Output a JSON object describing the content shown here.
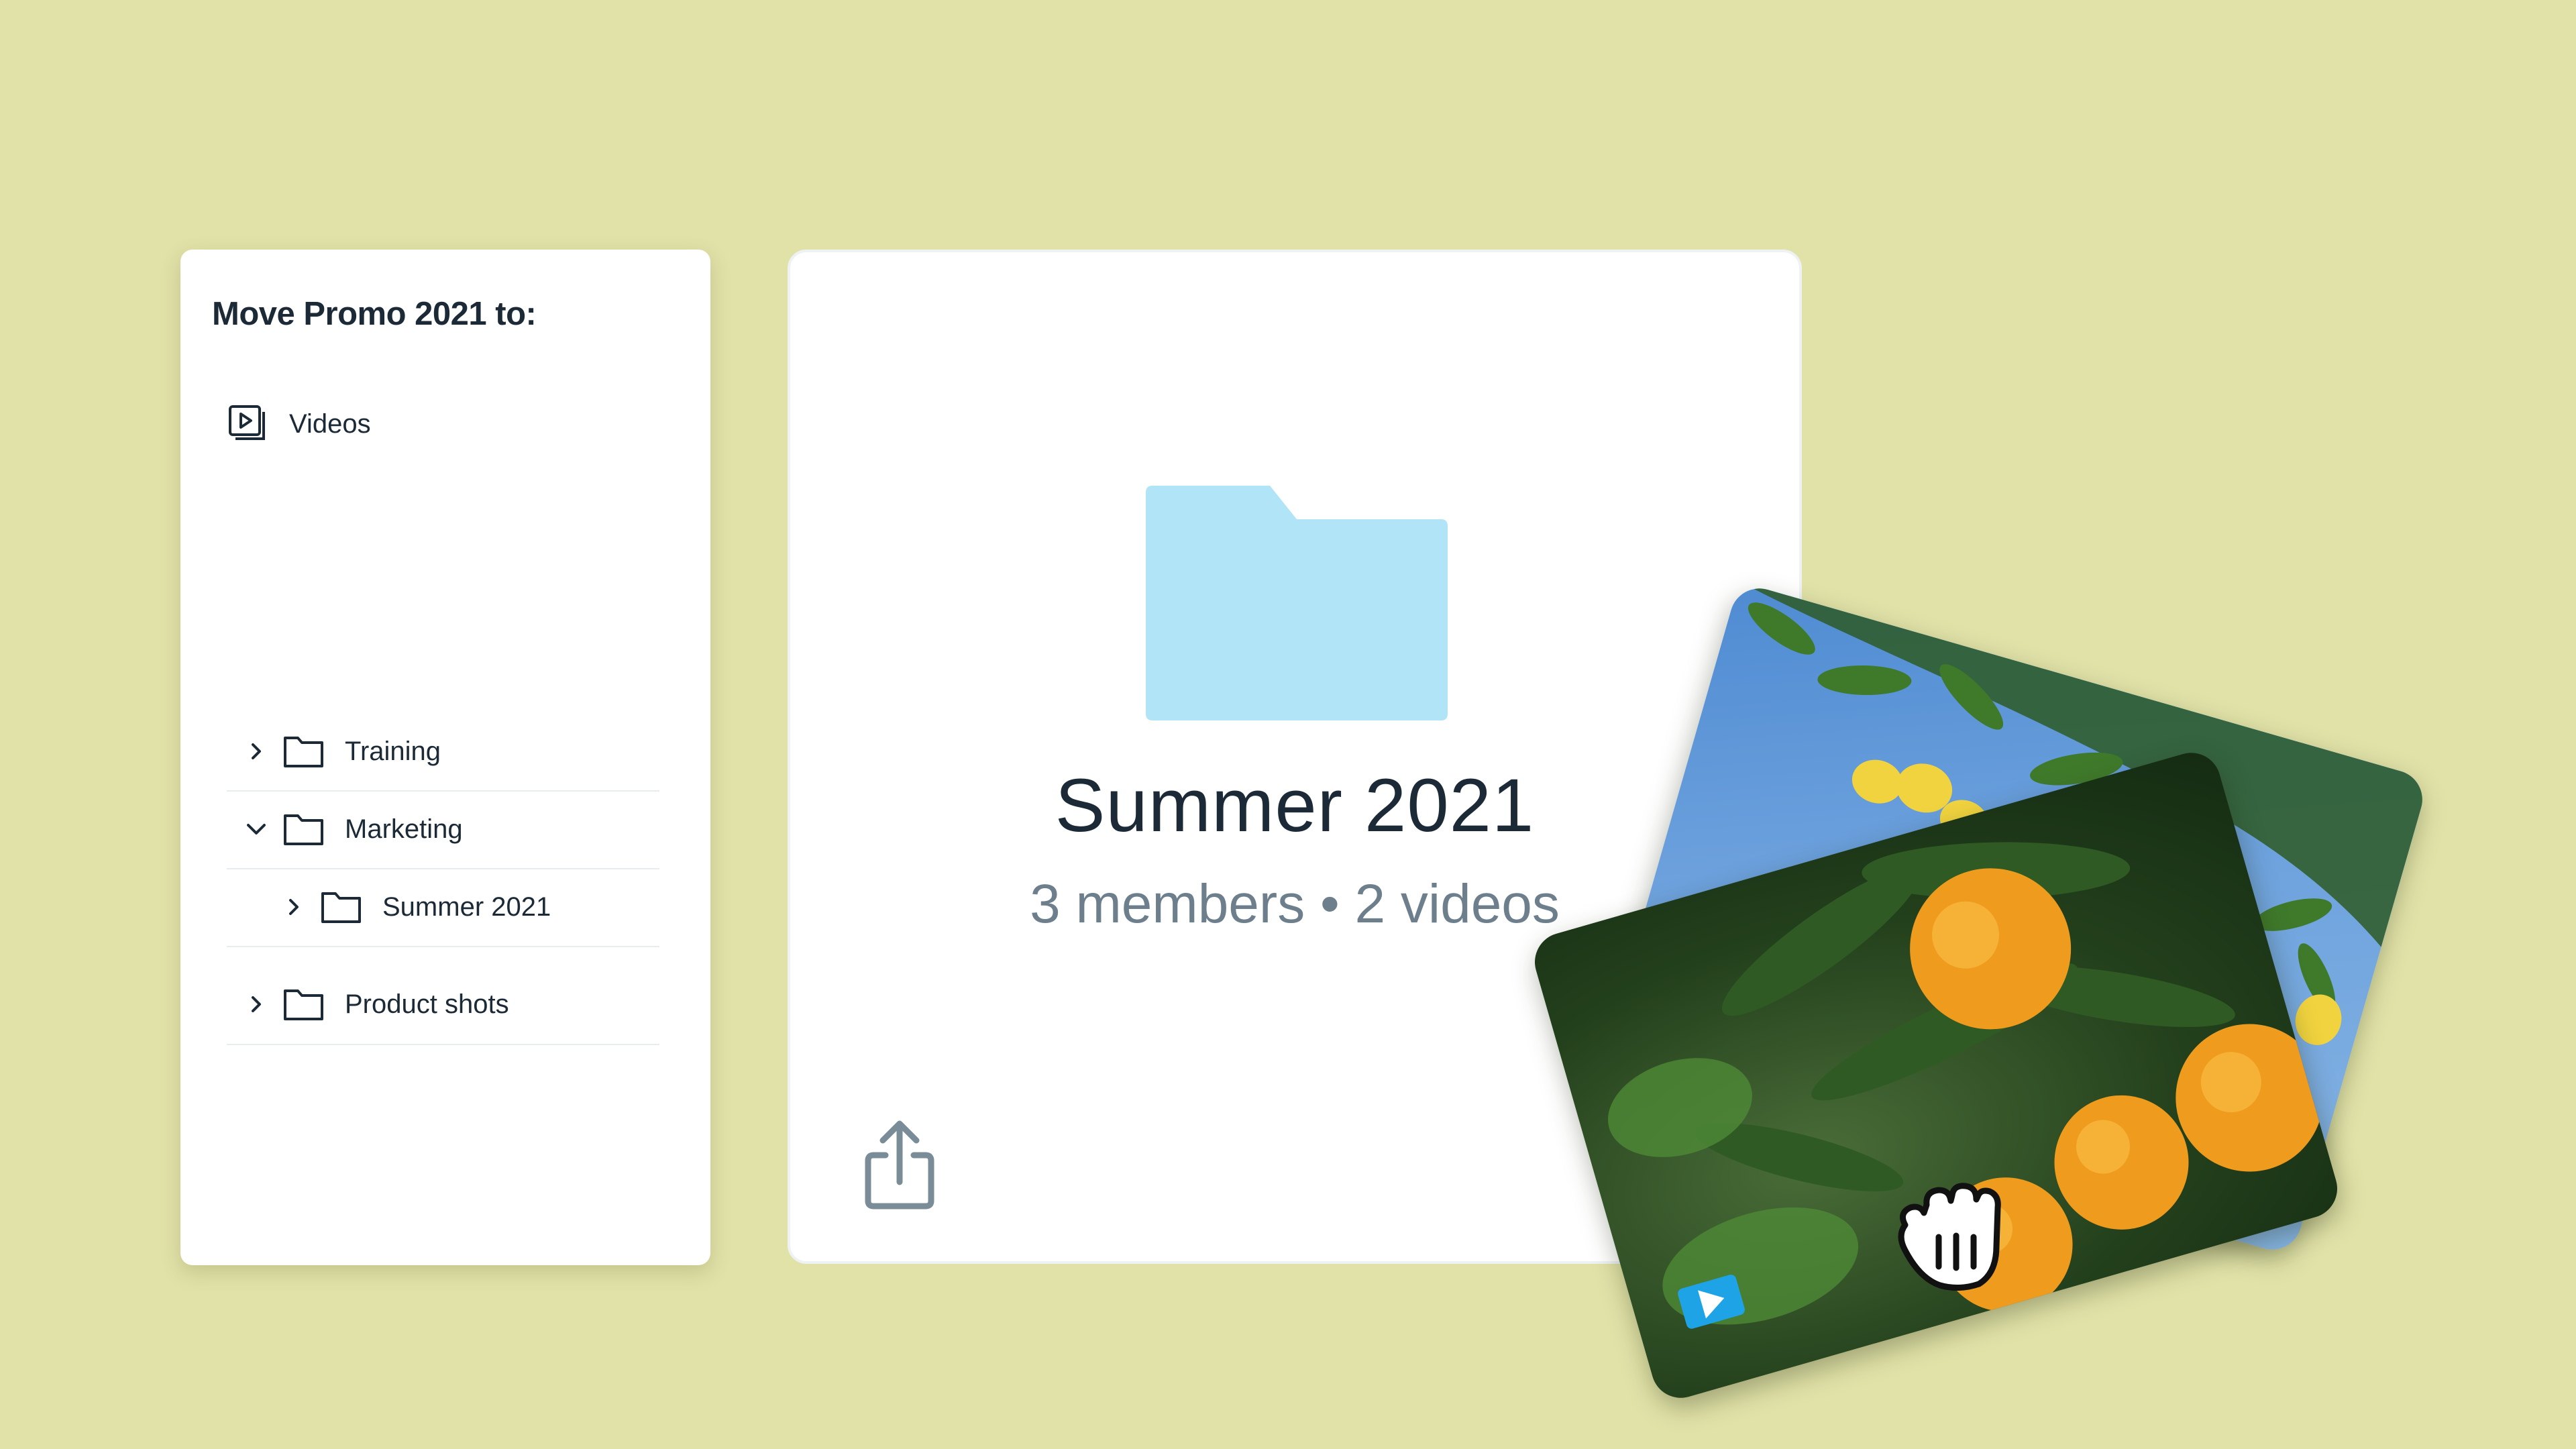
{
  "move_dialog": {
    "title": "Move Promo 2021 to:",
    "root": {
      "label": "Videos",
      "icon": "video-library-icon"
    },
    "items": [
      {
        "label": "Training",
        "expanded": false,
        "icon": "folder-icon"
      },
      {
        "label": "Marketing",
        "expanded": true,
        "icon": "folder-icon"
      },
      {
        "label": "Summer 2021",
        "expanded": false,
        "icon": "folder-icon"
      },
      {
        "label": "Product shots",
        "expanded": false,
        "icon": "folder-icon"
      }
    ]
  },
  "folder_card": {
    "name": "Summer 2021",
    "meta": "3 members • 2 videos",
    "folder_color": "#b2e4f7",
    "share_icon": "share-icon"
  },
  "drag_preview": {
    "back_image": "lemon-tree-photo",
    "front_image": "orange-tree-photo",
    "badge_icon": "play-icon",
    "cursor_icon": "grab-hand-icon"
  },
  "colors": {
    "background": "#e1e2a8",
    "text_primary": "#1b2a36",
    "text_secondary": "#6d7f8c",
    "accent": "#1ea3e6"
  }
}
